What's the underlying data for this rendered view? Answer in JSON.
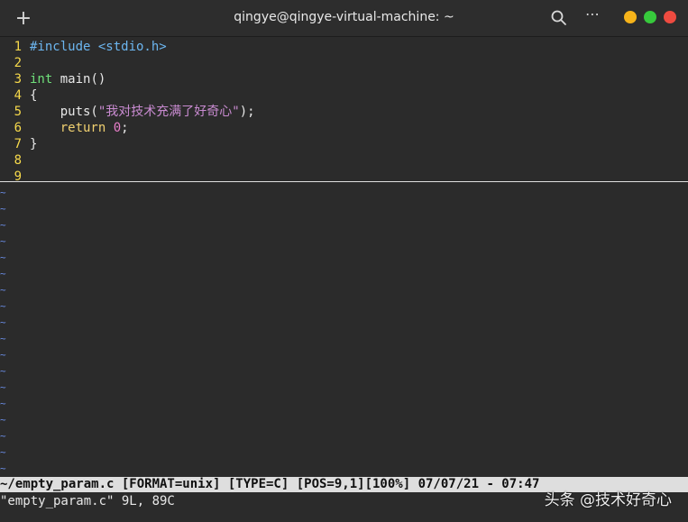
{
  "window": {
    "title": "qingye@qingye-virtual-machine: ~",
    "new_tab_symbol": "+",
    "menu_symbol": "⋯",
    "controls": {
      "minimize_color": "#f6b31a",
      "maximize_color": "#37c93c",
      "close_color": "#ee4b40"
    }
  },
  "editor": {
    "lines": [
      {
        "num": "1",
        "parts": [
          {
            "t": "#include <stdio.h>",
            "c": "kw-inc"
          }
        ]
      },
      {
        "num": "2",
        "parts": []
      },
      {
        "num": "3",
        "parts": [
          {
            "t": "int",
            "c": "kw-type"
          },
          {
            "t": " main()",
            "c": ""
          }
        ]
      },
      {
        "num": "4",
        "parts": [
          {
            "t": "{",
            "c": ""
          }
        ]
      },
      {
        "num": "5",
        "parts": [
          {
            "t": "    puts(",
            "c": ""
          },
          {
            "t": "\"我对技术充满了好奇心\"",
            "c": "str"
          },
          {
            "t": ");",
            "c": ""
          }
        ]
      },
      {
        "num": "6",
        "parts": [
          {
            "t": "    ",
            "c": ""
          },
          {
            "t": "return",
            "c": "kw-ret"
          },
          {
            "t": " ",
            "c": ""
          },
          {
            "t": "0",
            "c": "num"
          },
          {
            "t": ";",
            "c": ""
          }
        ]
      },
      {
        "num": "7",
        "parts": [
          {
            "t": "}",
            "c": ""
          }
        ]
      },
      {
        "num": "8",
        "parts": []
      },
      {
        "num": "9",
        "parts": []
      }
    ],
    "empty_line_marker": "~",
    "empty_line_count": 18
  },
  "statusline": "~/empty_param.c [FORMAT=unix] [TYPE=C] [POS=9,1][100%] 07/07/21 - 07:47",
  "cmdline": "\"empty_param.c\" 9L, 89C",
  "watermark": "头条 @技术好奇心"
}
